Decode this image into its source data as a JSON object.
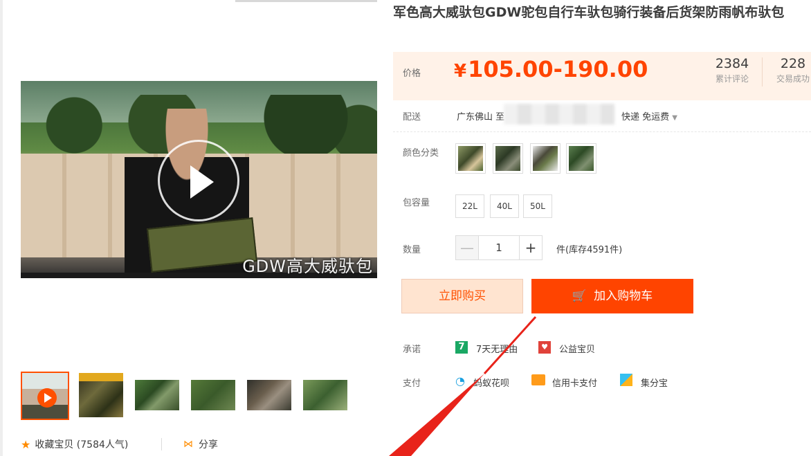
{
  "product": {
    "title": "军色高大威驮包GDW驼包自行车驮包骑行装备后货架防雨帆布驮包"
  },
  "video": {
    "caption": "GDW高大威驮包"
  },
  "price": {
    "label": "价格",
    "currency": "¥",
    "range": "105.00-190.00",
    "reviews_count": "2384",
    "reviews_label": "累计评论",
    "sales_count": "228",
    "sales_label": "交易成功"
  },
  "delivery": {
    "label": "配送",
    "from": "广东佛山 至",
    "method": "快递 免运费"
  },
  "colors": {
    "label": "颜色分类"
  },
  "capacity": {
    "label": "包容量",
    "options": [
      "22L",
      "40L",
      "50L"
    ]
  },
  "quantity": {
    "label": "数量",
    "minus": "—",
    "value": "1",
    "plus": "+",
    "stock": "件(库存4591件)"
  },
  "actions": {
    "buy_now": "立即购买",
    "add_to_cart": "加入购物车"
  },
  "promise": {
    "label": "承诺",
    "seven_icon": "7",
    "seven_days": "7天无理由",
    "charity": "公益宝贝"
  },
  "payment": {
    "label": "支付",
    "huabei": "蚂蚁花呗",
    "credit": "信用卡支付",
    "jifen": "集分宝"
  },
  "footer": {
    "favorite": "收藏宝贝 (7584人气)",
    "share": "分享"
  },
  "colors_meta": {
    "accent": "#ff4400",
    "price_bg": "#fff2e8",
    "buy_bg": "#ffe4d0"
  }
}
